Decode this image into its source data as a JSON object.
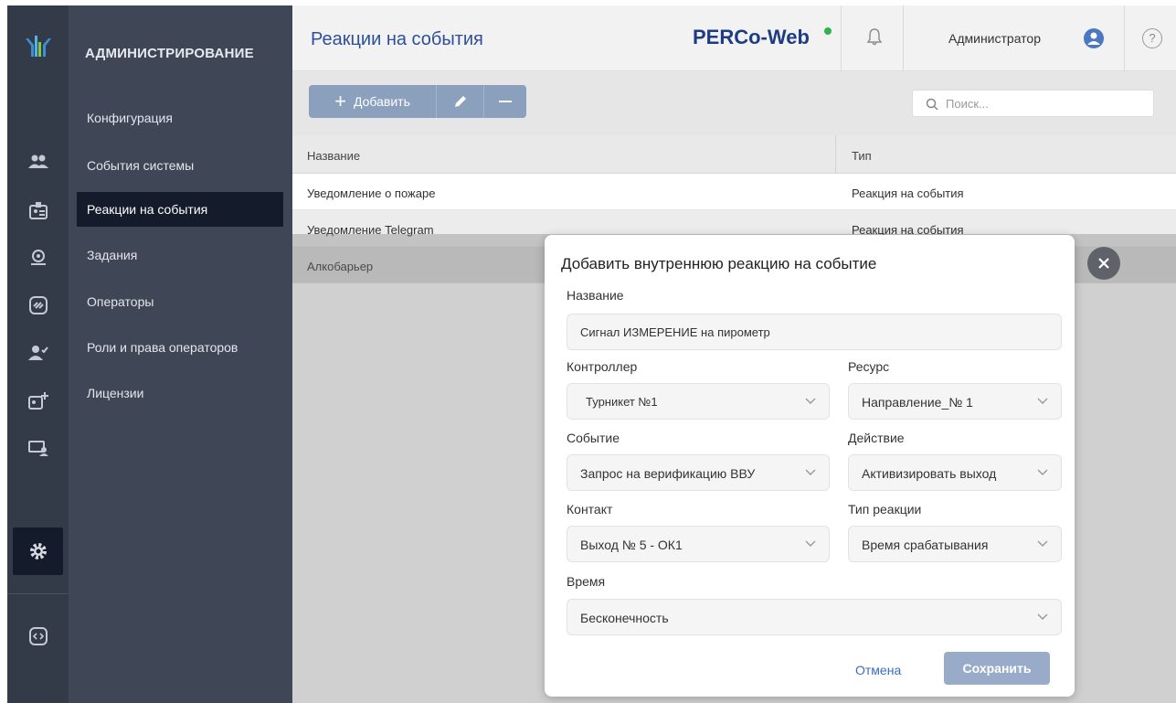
{
  "sidebar": {
    "title": "АДМИНИСТРИРОВАНИЕ",
    "items": [
      {
        "label": "Конфигурация"
      },
      {
        "label": "События системы"
      },
      {
        "label": "Реакции на события"
      },
      {
        "label": "Задания"
      },
      {
        "label": "Операторы"
      },
      {
        "label": "Роли и права операторов"
      },
      {
        "label": "Лицензии"
      }
    ],
    "active_index": 2
  },
  "rail": {
    "icons": [
      "logo-icon",
      "users-icon",
      "badge-icon",
      "visitor-icon",
      "link-icon",
      "verified-user-icon",
      "add-badge-icon",
      "monitor-user-icon",
      "gear-icon",
      "code-icon"
    ]
  },
  "header": {
    "title": "Реакции на события",
    "brand": "PERCo-Web",
    "user": "Администратор",
    "help": "?"
  },
  "toolbar": {
    "add_label": "Добавить",
    "search_placeholder": "Поиск..."
  },
  "table": {
    "columns": [
      "Название",
      "Тип"
    ],
    "rows": [
      [
        "Уведомление о пожаре",
        "Реакция на события"
      ],
      [
        "Уведомление Telegram",
        "Реакция на события"
      ],
      [
        "Алкобарьер",
        ""
      ]
    ]
  },
  "dialog": {
    "title": "Добавить внутреннюю реакцию на событие",
    "name_label": "Название",
    "name_value": "Сигнал ИЗМЕРЕНИЕ на пирометр",
    "controller_label": "Контроллер",
    "controller_value": "Турникет №1",
    "resource_label": "Ресурс",
    "resource_value": "Направление_№ 1",
    "event_label": "Событие",
    "event_value": "Запрос на верификацию ВВУ",
    "action_label": "Действие",
    "action_value": "Активизировать выход",
    "contact_label": "Контакт",
    "contact_value": "Выход № 5 - ОК1",
    "reaction_type_label": "Тип реакции",
    "reaction_type_value": "Время срабатывания",
    "time_label": "Время",
    "time_value": "Бесконечность",
    "cancel_label": "Отмена",
    "save_label": "Сохранить"
  },
  "colors": {
    "rail": "#333b49",
    "sidebar": "#3f4757",
    "active": "#141c2c",
    "brand": "#1f3c83",
    "accent": "#3a6cc0"
  }
}
